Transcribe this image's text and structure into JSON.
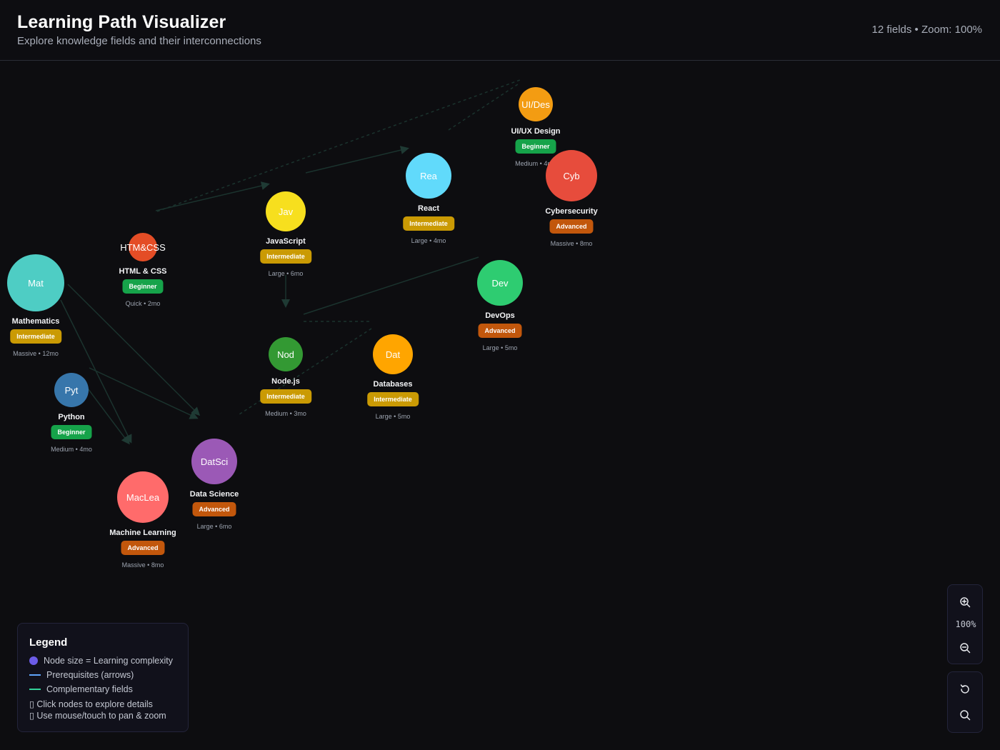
{
  "header": {
    "title": "Learning Path Visualizer",
    "subtitle": "Explore knowledge fields and their interconnections",
    "stats": "12 fields • Zoom: 100%"
  },
  "colors": {
    "beginner": "#16a34a",
    "intermediate": "#ca9a04",
    "advanced": "#c2570c",
    "prerequisite_line": "#60a5fa",
    "complementary_line": "#34d399",
    "size_dot": "#6c5ce7"
  },
  "nodes": [
    {
      "id": "math",
      "abbr": "Mat",
      "name": "Mathematics",
      "level": "Intermediate",
      "meta": "Massive • 12mo",
      "color": "#4ecdc4"
    },
    {
      "id": "htmlcss",
      "abbr": "HTM&CSS",
      "name": "HTML & CSS",
      "level": "Beginner",
      "meta": "Quick • 2mo",
      "color": "#e44d26"
    },
    {
      "id": "python",
      "abbr": "Pyt",
      "name": "Python",
      "level": "Beginner",
      "meta": "Medium • 4mo",
      "color": "#3776ab"
    },
    {
      "id": "js",
      "abbr": "Jav",
      "name": "JavaScript",
      "level": "Intermediate",
      "meta": "Large • 6mo",
      "color": "#f7df1e"
    },
    {
      "id": "react",
      "abbr": "Rea",
      "name": "React",
      "level": "Intermediate",
      "meta": "Large • 4mo",
      "color": "#61dafb"
    },
    {
      "id": "uiux",
      "abbr": "UI/Des",
      "name": "UI/UX Design",
      "level": "Beginner",
      "meta": "Medium • 4mo",
      "color": "#f39c12"
    },
    {
      "id": "cyber",
      "abbr": "Cyb",
      "name": "Cybersecurity",
      "level": "Advanced",
      "meta": "Massive • 8mo",
      "color": "#e74c3c"
    },
    {
      "id": "devops",
      "abbr": "Dev",
      "name": "DevOps",
      "level": "Advanced",
      "meta": "Large • 5mo",
      "color": "#2ecc71"
    },
    {
      "id": "node",
      "abbr": "Nod",
      "name": "Node.js",
      "level": "Intermediate",
      "meta": "Medium • 3mo",
      "color": "#339933"
    },
    {
      "id": "db",
      "abbr": "Dat",
      "name": "Databases",
      "level": "Intermediate",
      "meta": "Large • 5mo",
      "color": "#ffa500"
    },
    {
      "id": "ds",
      "abbr": "DatSci",
      "name": "Data Science",
      "level": "Advanced",
      "meta": "Large • 6mo",
      "color": "#9b59b6"
    },
    {
      "id": "ml",
      "abbr": "MacLea",
      "name": "Machine Learning",
      "level": "Advanced",
      "meta": "Massive • 8mo",
      "color": "#ff6b6b"
    }
  ],
  "legend": {
    "title": "Legend",
    "size": "Node size = Learning complexity",
    "prereq": "Prerequisites (arrows)",
    "complementary": "Complementary fields",
    "tip_click": "▯ Click nodes to explore details",
    "tip_pan": "▯ Use mouse/touch to pan & zoom"
  },
  "controls": {
    "zoom_level": "100%",
    "icons": [
      "zoom-in-icon",
      "zoom-out-icon",
      "reset-icon",
      "search-icon"
    ]
  }
}
